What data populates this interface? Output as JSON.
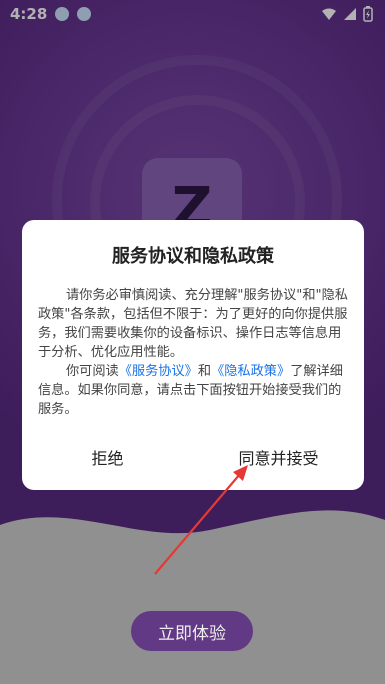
{
  "status_bar": {
    "time": "4:28"
  },
  "splash": {
    "logo_glyph": "Z",
    "start_button": "立即体验"
  },
  "dialog": {
    "title": "服务协议和隐私政策",
    "paragraph1": "请你务必审慎阅读、充分理解\"服务协议\"和\"隐私政策\"各条款，包括但不限于：为了更好的向你提供服务，我们需要收集你的设备标识、操作日志等信息用于分析、优化应用性能。",
    "paragraph2_prefix": "你可阅读",
    "link_service": "《服务协议》",
    "paragraph2_and": "和",
    "link_privacy": "《隐私政策》",
    "paragraph2_suffix": "了解详细信息。如果你同意，请点击下面按钮开始接受我们的服务。",
    "reject_button": "拒绝",
    "accept_button": "同意并接受"
  },
  "colors": {
    "background": "#5a2a83",
    "link": "#1a73e8",
    "annotation_arrow": "#e53935"
  }
}
